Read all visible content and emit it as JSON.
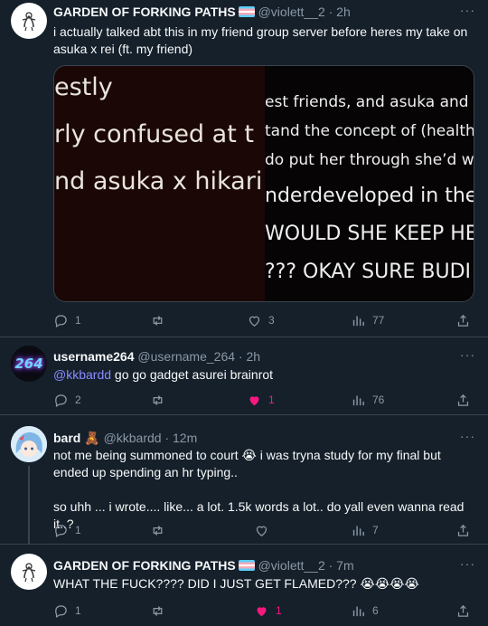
{
  "tweets": [
    {
      "display_name": "GARDEN OF FORKING PATHS",
      "handle_time": "@violett__2 · 2h",
      "text": "i actually talked abt this in my friend group server before heres my take on asuka x rei (ft. my friend)",
      "media": {
        "left_lines": [
          "estly",
          "rly confused at t",
          "nd asuka x hikari"
        ],
        "right_lines": [
          "est friends, and asuka and sh",
          "tand the concept of (healthy",
          "do put her through she’d war",
          "nderdeveloped in the",
          "WOULD SHE KEEP HE",
          "??? OKAY SURE BUDI"
        ]
      },
      "actions": {
        "replies": "1",
        "retweets": "",
        "likes": "3",
        "views": "77"
      },
      "liked": false
    },
    {
      "display_name": "username264",
      "handle_time": "@username_264 · 2h",
      "avatar_text": "264",
      "mention": "@kkbardd",
      "text": " go go gadget asurei brainrot",
      "actions": {
        "replies": "2",
        "retweets": "",
        "likes": "1",
        "views": "76"
      },
      "liked": true
    },
    {
      "display_name": "bard",
      "name_emoji": "🧸",
      "handle_time": "@kkbardd · 12m",
      "text_line1": "not me being summoned to court 😭 i was tryna study for my final but ended up spending an hr typing..",
      "text_line2": "so uhh ... i wrote.... like... a lot. 1.5k words a lot.. do yall even wanna read it..?",
      "actions": {
        "replies": "1",
        "retweets": "",
        "likes": "",
        "views": "7"
      },
      "liked": false
    },
    {
      "display_name": "GARDEN OF FORKING PATHS",
      "handle_time": "@violett__2 · 7m",
      "text": "WHAT THE FUCK???? DID I JUST GET FLAMED??? 😭😭😭😭",
      "actions": {
        "replies": "1",
        "retweets": "",
        "likes": "1",
        "views": "6"
      },
      "liked": true
    }
  ],
  "colors": {
    "background": "#15202b",
    "text": "#f7f9f9",
    "muted": "#8b98a5",
    "like": "#f91880",
    "mention": "#8b8bff"
  },
  "icons": [
    "reply-icon",
    "retweet-icon",
    "like-icon",
    "views-icon",
    "share-icon",
    "more-icon"
  ]
}
